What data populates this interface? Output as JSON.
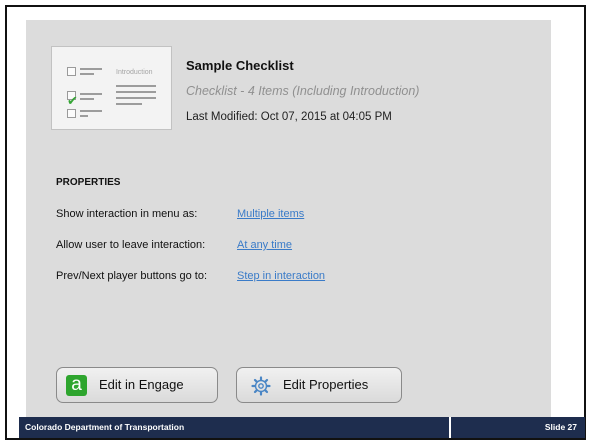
{
  "checklist": {
    "title": "Sample Checklist",
    "subtitle": "Checklist - 4 Items (Including Introduction)",
    "last_modified": "Last Modified: Oct 07, 2015 at 04:05 PM",
    "thumbnail_label": "Introduction",
    "thumbnail_check_color": "#35a535"
  },
  "properties": {
    "heading": "PROPERTIES",
    "items": [
      {
        "label": "Show interaction in menu as:",
        "value": "Multiple items"
      },
      {
        "label": "Allow user to leave interaction:",
        "value": "At any time"
      },
      {
        "label": "Prev/Next player buttons go to:",
        "value": "Step in interaction"
      }
    ],
    "link_color": "#3a7bc8"
  },
  "buttons": {
    "engage": {
      "label": "Edit in Engage",
      "icon": "engage-icon",
      "icon_glyph": "a",
      "icon_color": "#2ea52e"
    },
    "properties": {
      "label": "Edit Properties",
      "icon": "gear-icon"
    }
  },
  "footer": {
    "organization": "Colorado Department of Transportation",
    "slide": "Slide 27",
    "background": "#1e2d4e"
  }
}
